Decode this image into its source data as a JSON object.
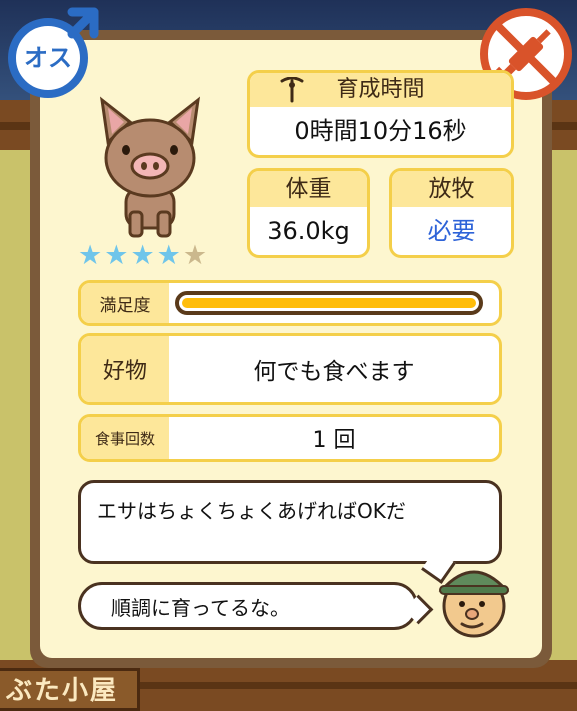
{
  "sex_badge": {
    "label": "オス",
    "icon": "male-symbol-icon"
  },
  "no_medicine_icon": "no-syringe-icon",
  "rating": {
    "filled": 4,
    "total": 5,
    "stars": [
      "★",
      "★",
      "★",
      "★",
      "★"
    ]
  },
  "growth_time": {
    "label": "育成時間",
    "value": "0時間10分16秒",
    "icon": "pin-icon"
  },
  "weight": {
    "label": "体重",
    "value": "36.0kg"
  },
  "grazing": {
    "label": "放牧",
    "value": "必要"
  },
  "satisfaction": {
    "label": "満足度",
    "level": 1.0
  },
  "favorite": {
    "label": "好物",
    "value": "何でも食べます"
  },
  "meals": {
    "label": "食事回数",
    "value": "1 回"
  },
  "dialog": {
    "line1": "エサはちょくちょくあげればOKだ",
    "line2": "順調に育ってるな。"
  },
  "bottom_sign": "ぶた小屋",
  "colors": {
    "accent": "#f4cf4a",
    "gauge": "#ffbd0a",
    "link_value": "#2e63d8",
    "star_on": "#6fc5ea"
  }
}
